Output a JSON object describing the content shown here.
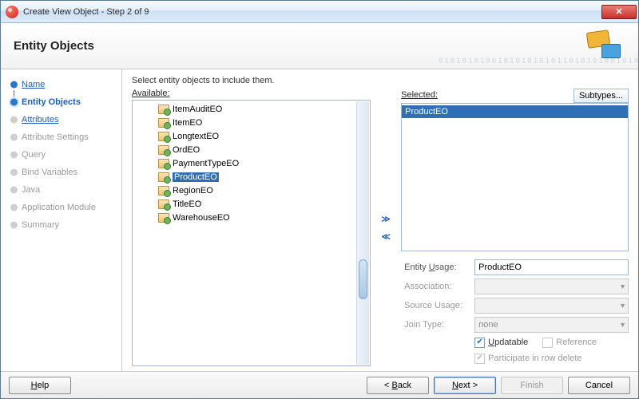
{
  "window": {
    "title": "Create View Object - Step 2 of 9"
  },
  "banner": {
    "heading": "Entity Objects",
    "bits": "0101010100101010101011010101001010101010"
  },
  "steps": [
    {
      "label": "Name",
      "state": "done"
    },
    {
      "label": "Entity Objects",
      "state": "current"
    },
    {
      "label": "Attributes",
      "state": "next"
    },
    {
      "label": "Attribute Settings",
      "state": "pending"
    },
    {
      "label": "Query",
      "state": "pending"
    },
    {
      "label": "Bind Variables",
      "state": "pending"
    },
    {
      "label": "Java",
      "state": "pending"
    },
    {
      "label": "Application Module",
      "state": "pending"
    },
    {
      "label": "Summary",
      "state": "pending"
    }
  ],
  "main": {
    "instruction": "Select entity objects to include them.",
    "available_label": "Available:",
    "selected_label": "Selected:",
    "subtypes_label": "Subtypes...",
    "available": [
      "ItemAuditEO",
      "ItemEO",
      "LongtextEO",
      "OrdEO",
      "PaymentTypeEO",
      "ProductEO",
      "RegionEO",
      "TitleEO",
      "WarehouseEO"
    ],
    "available_selected_index": 5,
    "selected": [
      "ProductEO"
    ]
  },
  "form": {
    "entity_usage_label": "Entity Usage:",
    "entity_usage_value": "ProductEO",
    "association_label": "Association:",
    "source_usage_label": "Source Usage:",
    "join_type_label": "Join Type:",
    "join_type_value": "none",
    "updatable_label": "Updatable",
    "reference_label": "Reference",
    "participate_label": "Participate in row delete"
  },
  "footer": {
    "help": "Help",
    "back": "< Back",
    "next": "Next >",
    "finish": "Finish",
    "cancel": "Cancel"
  }
}
